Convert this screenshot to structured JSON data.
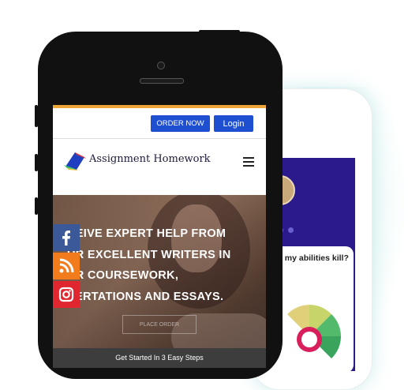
{
  "header": {
    "order_label": "ORDER NOW",
    "login_label": "Login",
    "brand_name": "Assignment Homework"
  },
  "hero": {
    "headline_lines": [
      "CEIVE EXPERT HELP FROM",
      "UR EXCELLENT WRITERS IN",
      "UR COURSEWORK,",
      "SERTATIONS AND ESSAYS."
    ],
    "place_order_label": "PLACE ORDER",
    "steps_text": "Get Started In 3 Easy Steps"
  },
  "social": {
    "items": [
      "facebook-icon",
      "rss-icon",
      "instagram-icon"
    ],
    "colors": {
      "facebook": "#3b5998",
      "rss": "#f27b1b",
      "instagram": "#e0262e"
    }
  },
  "back_phone": {
    "question": "e my abilities kill?"
  },
  "colors": {
    "accent_bar": "#f0a637",
    "button_blue": "#1f4fd1",
    "back_screen": "#2b1a8c"
  }
}
